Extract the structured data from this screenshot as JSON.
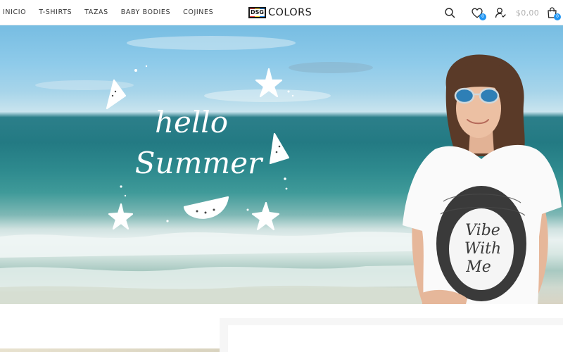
{
  "nav": {
    "items": [
      {
        "label": "INICIO"
      },
      {
        "label": "T-SHIRTS"
      },
      {
        "label": "TAZAS"
      },
      {
        "label": "BABY BODIES"
      },
      {
        "label": "COJINES"
      }
    ]
  },
  "logo": {
    "mark": "DSG",
    "text": "COLORS"
  },
  "header": {
    "wishlist_count": "0",
    "cart_count": "0",
    "cart_total": "$0,00",
    "icons": [
      "search-icon",
      "heart-icon",
      "user-icon",
      "shopping-bag-icon"
    ]
  },
  "hero": {
    "greeting_line1": "hello",
    "greeting_line2": "Summer",
    "shirt_text": [
      "Vibe",
      "With",
      "Me"
    ]
  },
  "colors": {
    "accent": "#2196f3",
    "text": "#333333",
    "muted": "#b0b0b0"
  }
}
